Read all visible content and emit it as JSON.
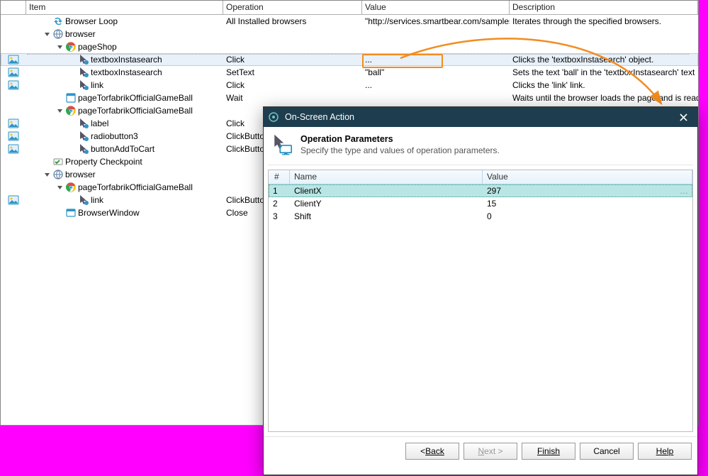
{
  "columns": {
    "item": "Item",
    "operation": "Operation",
    "value": "Value",
    "description": "Description"
  },
  "rows": [
    {
      "indent": 0,
      "toggle": "",
      "icon": "loop",
      "gutter": "",
      "label": "Browser Loop",
      "op": "All Installed browsers",
      "val": "\"http://services.smartbear.com/samples/",
      "desc": "Iterates through the specified browsers.",
      "hl": false
    },
    {
      "indent": 0,
      "toggle": "open",
      "icon": "globe",
      "gutter": "",
      "label": "browser",
      "op": "",
      "val": "",
      "desc": "",
      "hl": false
    },
    {
      "indent": 1,
      "toggle": "open",
      "icon": "chrome",
      "gutter": "",
      "label": "pageShop",
      "op": "",
      "val": "",
      "desc": "",
      "hl": false
    },
    {
      "indent": 2,
      "toggle": "",
      "icon": "action",
      "gutter": "img",
      "label": "textboxInstasearch",
      "op": "Click",
      "val": "...",
      "desc": "Clicks the 'textboxInstasearch' object.",
      "hl": true
    },
    {
      "indent": 2,
      "toggle": "",
      "icon": "action",
      "gutter": "img",
      "label": "textboxInstasearch",
      "op": "SetText",
      "val": "\"ball\"",
      "desc": "Sets the text 'ball' in the 'textboxInstasearch' text",
      "hl": false
    },
    {
      "indent": 2,
      "toggle": "",
      "icon": "action",
      "gutter": "img",
      "label": "link",
      "op": "Click",
      "val": "...",
      "desc": "Clicks the 'link' link.",
      "hl": false
    },
    {
      "indent": 1,
      "toggle": "",
      "icon": "page",
      "gutter": "",
      "label": "pageTorfabrikOfficialGameBall",
      "op": "Wait",
      "val": "",
      "desc": "Waits until the browser loads the page and is read",
      "hl": false
    },
    {
      "indent": 1,
      "toggle": "open",
      "icon": "chrome",
      "gutter": "",
      "label": "pageTorfabrikOfficialGameBall",
      "op": "",
      "val": "",
      "desc": "",
      "hl": false
    },
    {
      "indent": 2,
      "toggle": "",
      "icon": "action",
      "gutter": "img",
      "label": "label",
      "op": "Click",
      "val": "",
      "desc": "",
      "hl": false
    },
    {
      "indent": 2,
      "toggle": "",
      "icon": "action",
      "gutter": "img",
      "label": "radiobutton3",
      "op": "ClickButto",
      "val": "",
      "desc": "",
      "hl": false
    },
    {
      "indent": 2,
      "toggle": "",
      "icon": "action",
      "gutter": "img",
      "label": "buttonAddToCart",
      "op": "ClickButto",
      "val": "",
      "desc": "",
      "hl": false
    },
    {
      "indent": 0,
      "toggle": "",
      "icon": "check",
      "gutter": "",
      "label": "Property Checkpoint",
      "op": "",
      "val": "",
      "desc": "",
      "hl": false
    },
    {
      "indent": 0,
      "toggle": "open",
      "icon": "globe",
      "gutter": "",
      "label": "browser",
      "op": "",
      "val": "",
      "desc": "",
      "hl": false
    },
    {
      "indent": 1,
      "toggle": "open",
      "icon": "chrome",
      "gutter": "",
      "label": "pageTorfabrikOfficialGameBall",
      "op": "",
      "val": "",
      "desc": "",
      "hl": false
    },
    {
      "indent": 2,
      "toggle": "",
      "icon": "action",
      "gutter": "img",
      "label": "link",
      "op": "ClickButto",
      "val": "",
      "desc": "",
      "hl": false
    },
    {
      "indent": 1,
      "toggle": "",
      "icon": "window",
      "gutter": "",
      "label": "BrowserWindow",
      "op": "Close",
      "val": "",
      "desc": "",
      "hl": false
    }
  ],
  "dialog": {
    "title": "On-Screen Action",
    "heading": "Operation Parameters",
    "sub": "Specify the type and values of operation parameters.",
    "cols": {
      "idx": "#",
      "name": "Name",
      "value": "Value"
    },
    "params": [
      {
        "idx": "1",
        "name": "ClientX",
        "value": "297",
        "sel": true
      },
      {
        "idx": "2",
        "name": "ClientY",
        "value": "15",
        "sel": false
      },
      {
        "idx": "3",
        "name": "Shift",
        "value": "0",
        "sel": false
      }
    ],
    "buttons": {
      "back": "Back",
      "next": "Next >",
      "finish": "Finish",
      "cancel": "Cancel",
      "help": "Help"
    }
  }
}
